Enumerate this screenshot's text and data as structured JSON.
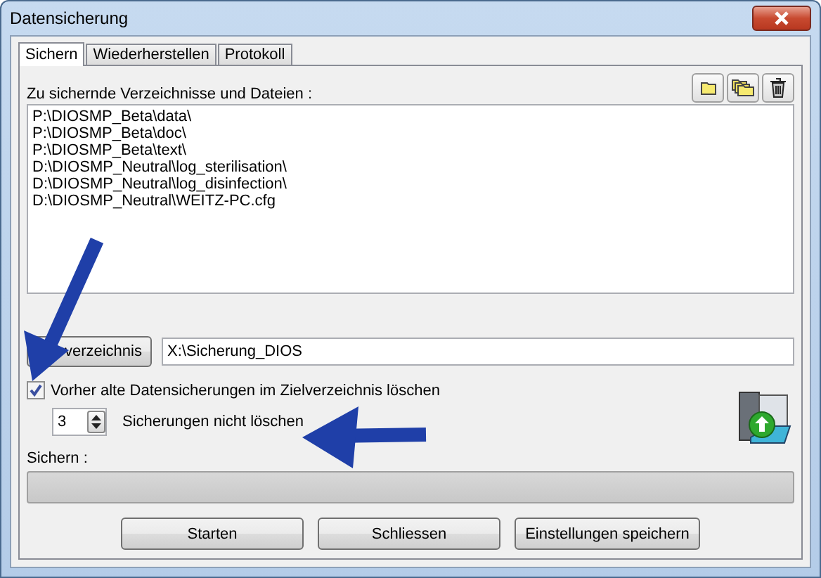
{
  "window": {
    "title": "Datensicherung"
  },
  "tabs": [
    {
      "label": "Sichern",
      "selected": true
    },
    {
      "label": "Wiederherstellen",
      "selected": false
    },
    {
      "label": "Protokoll",
      "selected": false
    }
  ],
  "list": {
    "label": "Zu sichernde Verzeichnisse und Dateien :",
    "items": [
      "P:\\DIOSMP_Beta\\data\\",
      "P:\\DIOSMP_Beta\\doc\\",
      "P:\\DIOSMP_Beta\\text\\",
      "D:\\DIOSMP_Neutral\\log_sterilisation\\",
      "D:\\DIOSMP_Neutral\\log_disinfection\\",
      "D:\\DIOSMP_Neutral\\WEITZ-PC.cfg"
    ]
  },
  "target": {
    "button": "verzeichnis",
    "value": "X:\\Sicherung_DIOS"
  },
  "delete_old": {
    "label": "Vorher alte Datensicherungen im Zielverzeichnis löschen",
    "checked": true
  },
  "keep": {
    "value": "3",
    "label": "Sicherungen nicht löschen"
  },
  "progress": {
    "label": "Sichern :",
    "level": 0
  },
  "buttons": [
    "Starten",
    "Schliessen",
    "Einstellungen speichern"
  ]
}
